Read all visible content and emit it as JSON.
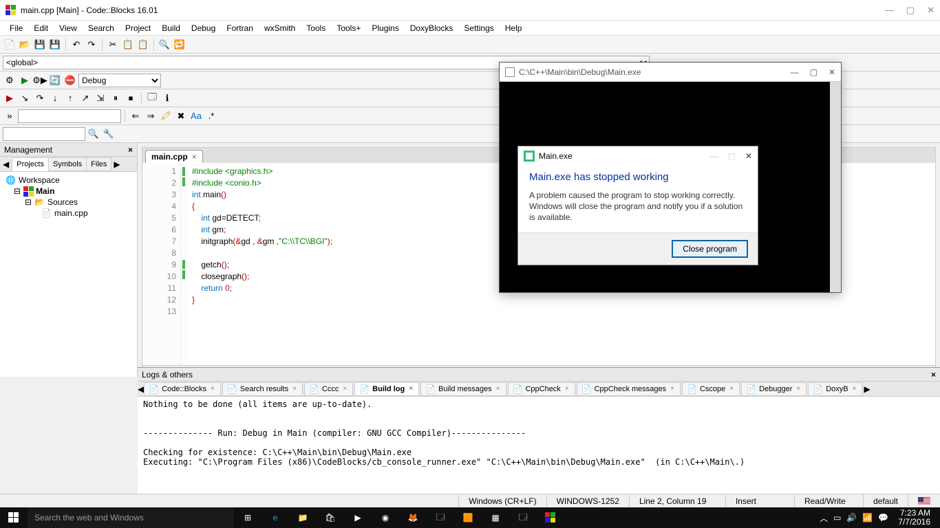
{
  "window": {
    "title": "main.cpp [Main] - Code::Blocks 16.01"
  },
  "menu": [
    "File",
    "Edit",
    "View",
    "Search",
    "Project",
    "Build",
    "Debug",
    "Fortran",
    "wxSmith",
    "Tools",
    "Tools+",
    "Plugins",
    "DoxyBlocks",
    "Settings",
    "Help"
  ],
  "scope_selector": "<global>",
  "build_target": "Debug",
  "management": {
    "title": "Management",
    "tabs": [
      "Projects",
      "Symbols",
      "Files"
    ],
    "active_tab": "Projects",
    "tree": {
      "root": "Workspace",
      "project": "Main",
      "folder": "Sources",
      "file": "main.cpp"
    }
  },
  "editor": {
    "tab": "main.cpp",
    "lines": [
      {
        "n": 1,
        "mark": "g",
        "html": "<span class='inc'>#include &lt;graphics.h&gt;</span>"
      },
      {
        "n": 2,
        "mark": "g",
        "html": "<span class='inc'>#include &lt;conio.h&gt;</span>"
      },
      {
        "n": 3,
        "mark": "",
        "html": "<span class='kw'>int</span> main<span class='brace'>()</span>"
      },
      {
        "n": 4,
        "mark": "",
        "html": "<span class='brace'>{</span>"
      },
      {
        "n": 5,
        "mark": "",
        "html": "    <span class='kw'>int</span> gd=DETECT<span class='brace'>;</span>"
      },
      {
        "n": 6,
        "mark": "",
        "html": "    <span class='kw'>int</span> gm<span class='brace'>;</span>"
      },
      {
        "n": 7,
        "mark": "",
        "html": "    initgraph<span class='brace'>(&amp;</span>gd <span class='brace'>, &amp;</span>gm <span class='brace'>,</span><span class='str'>\"C:\\\\TC\\\\BGI\"</span><span class='brace'>);</span>"
      },
      {
        "n": 8,
        "mark": "",
        "html": ""
      },
      {
        "n": 9,
        "mark": "",
        "html": "    getch<span class='brace'>();</span>"
      },
      {
        "n": 10,
        "mark": "g",
        "html": "    closegraph<span class='brace'>();</span>"
      },
      {
        "n": 11,
        "mark": "g",
        "html": "    <span class='kw'>return</span> <span class='num'>0</span><span class='brace'>;</span>"
      },
      {
        "n": 12,
        "mark": "",
        "html": "<span class='brace'>}</span>"
      },
      {
        "n": 13,
        "mark": "",
        "html": ""
      }
    ]
  },
  "logs": {
    "title": "Logs & others",
    "tabs": [
      "Code::Blocks",
      "Search results",
      "Cccc",
      "Build log",
      "Build messages",
      "CppCheck",
      "CppCheck messages",
      "Cscope",
      "Debugger",
      "DoxyB"
    ],
    "active": "Build log",
    "body": "Nothing to be done (all items are up-to-date).\n\n\n-------------- Run: Debug in Main (compiler: GNU GCC Compiler)---------------\n\nChecking for existence: C:\\C++\\Main\\bin\\Debug\\Main.exe\nExecuting: \"C:\\Program Files (x86)\\CodeBlocks/cb_console_runner.exe\" \"C:\\C++\\Main\\bin\\Debug\\Main.exe\"  (in C:\\C++\\Main\\.)"
  },
  "statusbar": {
    "eol": "Windows (CR+LF)",
    "encoding": "WINDOWS-1252",
    "pos": "Line 2, Column 19",
    "mode": "Insert",
    "rw": "Read/Write",
    "profile": "default"
  },
  "console": {
    "title": "C:\\C++\\Main\\bin\\Debug\\Main.exe"
  },
  "error_dialog": {
    "title": "Main.exe",
    "heading": "Main.exe has stopped working",
    "text": "A problem caused the program to stop working correctly. Windows will close the program and notify you if a solution is available.",
    "button": "Close program"
  },
  "taskbar": {
    "search_placeholder": "Search the web and Windows",
    "time": "7:23 AM",
    "date": "7/7/2016"
  }
}
